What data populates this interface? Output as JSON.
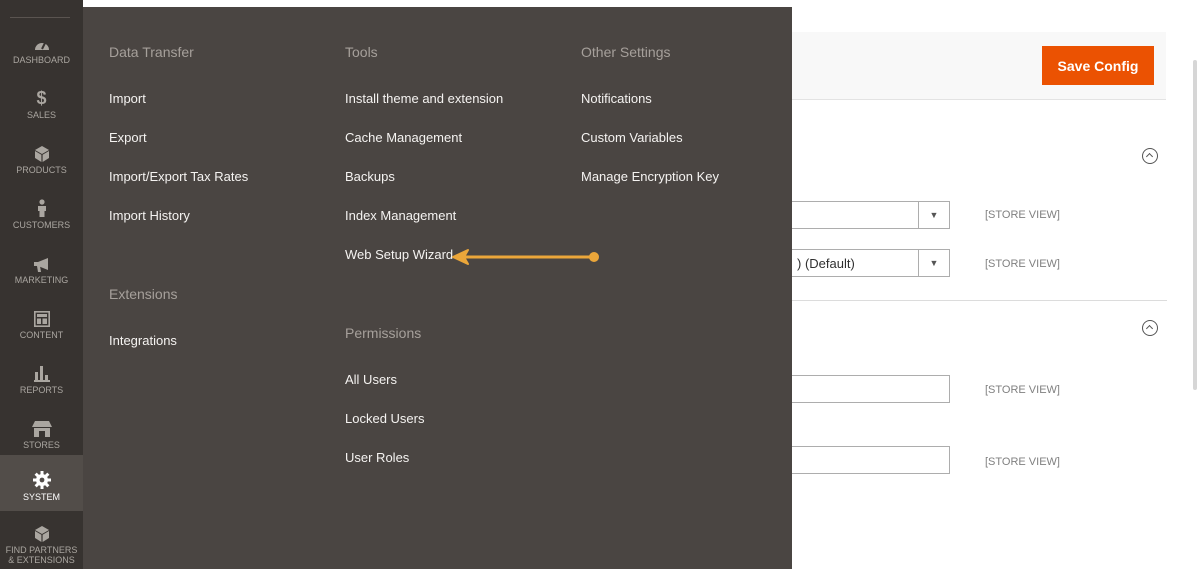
{
  "sidebar": {
    "items": [
      {
        "label": "DASHBOARD",
        "icon": "speedometer-icon"
      },
      {
        "label": "SALES",
        "icon": "dollar-icon"
      },
      {
        "label": "PRODUCTS",
        "icon": "box-icon"
      },
      {
        "label": "CUSTOMERS",
        "icon": "person-icon"
      },
      {
        "label": "MARKETING",
        "icon": "megaphone-icon"
      },
      {
        "label": "CONTENT",
        "icon": "layout-icon"
      },
      {
        "label": "REPORTS",
        "icon": "bar-chart-icon"
      },
      {
        "label": "STORES",
        "icon": "storefront-icon"
      },
      {
        "label": "SYSTEM",
        "icon": "gear-icon"
      },
      {
        "label": "FIND PARTNERS\n& EXTENSIONS",
        "icon": "partners-box-icon"
      }
    ],
    "active": "SYSTEM"
  },
  "flyout": {
    "data_transfer": {
      "title": "Data Transfer",
      "links": [
        "Import",
        "Export",
        "Import/Export Tax Rates",
        "Import History"
      ]
    },
    "extensions": {
      "title": "Extensions",
      "links": [
        "Integrations"
      ]
    },
    "tools": {
      "title": "Tools",
      "links": [
        "Install theme and extension",
        "Cache Management",
        "Backups",
        "Index Management",
        "Web Setup Wizard"
      ]
    },
    "permissions": {
      "title": "Permissions",
      "links": [
        "All Users",
        "Locked Users",
        "User Roles"
      ]
    },
    "other_settings": {
      "title": "Other Settings",
      "links": [
        "Notifications",
        "Custom Variables",
        "Manage Encryption Key"
      ]
    }
  },
  "config": {
    "save_label": "Save Config",
    "select_2_value": ") (Default)",
    "scope_label": "[STORE VIEW]"
  },
  "colors": {
    "accent": "#eb5202",
    "annotation_arrow": "#eba63a",
    "sidebar_bg": "#373330",
    "flyout_bg": "#4a4542"
  }
}
